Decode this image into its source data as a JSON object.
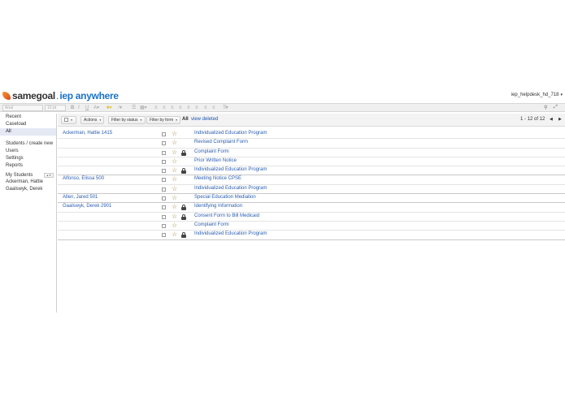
{
  "app": {
    "logo_same": "samegoal",
    "logo_sep": ".",
    "logo_iep": "iep anywhere",
    "user": "iep_helpdesk_hd_718"
  },
  "format_bar": {
    "font": "Arial",
    "size": "10 pt"
  },
  "sidebar": {
    "items": [
      {
        "label": "Recent",
        "active": false
      },
      {
        "label": "Caseload",
        "active": false
      },
      {
        "label": "All",
        "active": true
      }
    ],
    "items2": [
      {
        "label": "Students / create new"
      },
      {
        "label": "Users"
      },
      {
        "label": "Settings"
      },
      {
        "label": "Reports"
      }
    ],
    "my_students_label": "My Students",
    "my_students": [
      {
        "label": "Ackerman, Hattie"
      },
      {
        "label": "Gaalswyk, Derek"
      }
    ]
  },
  "toolbar": {
    "actions": "Actions",
    "filter_status": "Filter by status",
    "filter_form": "Filter by form",
    "all": "All",
    "view_deleted": "view deleted",
    "pager": "1 - 12 of 12"
  },
  "rows": [
    {
      "student": "Ackerman, Hattie  1415",
      "form": "Individualized Education Program",
      "locked": false
    },
    {
      "student": "",
      "form": "Revised Complaint Form",
      "locked": false
    },
    {
      "student": "",
      "form": "Complaint Form",
      "locked": true
    },
    {
      "student": "",
      "form": "Prior Written Notice",
      "locked": false
    },
    {
      "student": "",
      "form": "Individualized Education Program",
      "locked": true
    },
    {
      "student": "Alfonso, Elissa  500",
      "form": "Meeting Notice CPSE",
      "locked": false
    },
    {
      "student": "",
      "form": "Individualized Education Program",
      "locked": false
    },
    {
      "student": "Allen, Jared  501",
      "form": "Special Education Mediation",
      "locked": false
    },
    {
      "student": "Gaalswyk, Derek  2901",
      "form": "Identifying Information",
      "locked": true
    },
    {
      "student": "",
      "form": "Consent Form to Bill Medicaid",
      "locked": true
    },
    {
      "student": "",
      "form": "Complaint Form",
      "locked": false
    },
    {
      "student": "",
      "form": "Individualized Education Program",
      "locked": true
    }
  ],
  "group_ends": [
    4,
    6,
    7,
    11
  ]
}
